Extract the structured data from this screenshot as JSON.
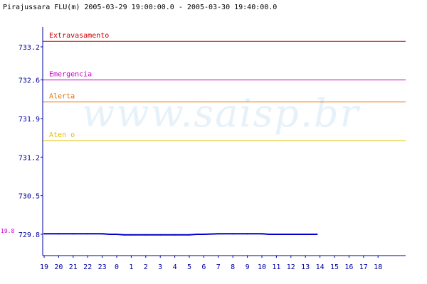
{
  "chart_data": {
    "type": "line",
    "title": "Pirajussara FLU(m) 2005-03-29 19:00:00.0 - 2005-03-30 19:40:00.0",
    "watermark": "www.saisp.br",
    "ylim": [
      729.8,
      733.5
    ],
    "y_ticks": [
      {
        "value": 733.2,
        "label": "733.2"
      },
      {
        "value": 732.6,
        "label": "732.6"
      },
      {
        "value": 731.9,
        "label": "731.9"
      },
      {
        "value": 731.2,
        "label": "731.2"
      },
      {
        "value": 730.5,
        "label": "730.5"
      },
      {
        "value": 729.8,
        "label": "729.8"
      }
    ],
    "x_ticks": [
      "19",
      "20",
      "21",
      "22",
      "23",
      "0",
      "1",
      "2",
      "3",
      "4",
      "5",
      "6",
      "7",
      "8",
      "9",
      "10",
      "11",
      "12",
      "13",
      "14",
      "15",
      "16",
      "17",
      "18"
    ],
    "thresholds": [
      {
        "name": "Extravasamento",
        "value": 733.3,
        "color": "#cc0000"
      },
      {
        "name": "Emergencia",
        "value": 732.6,
        "color": "#cc00cc"
      },
      {
        "name": "Alerta",
        "value": 732.2,
        "color": "#e07000"
      },
      {
        "name": "Aten  o",
        "value": 731.5,
        "color": "#e0c000"
      }
    ],
    "series": [
      {
        "color": "#0000cc",
        "x": [
          0,
          1,
          2,
          3,
          4,
          4.5,
          5,
          5.5,
          6,
          7,
          8,
          9,
          10,
          10.5,
          11,
          12,
          13,
          14,
          15,
          15.5,
          16,
          17,
          18,
          18.8
        ],
        "values": [
          729.81,
          729.81,
          729.81,
          729.81,
          729.81,
          729.8,
          729.8,
          729.79,
          729.79,
          729.79,
          729.79,
          729.79,
          729.79,
          729.8,
          729.8,
          729.81,
          729.81,
          729.81,
          729.81,
          729.8,
          729.8,
          729.8,
          729.8,
          729.8
        ]
      }
    ],
    "current_value": {
      "label": "19.8",
      "color": "#cc00cc"
    },
    "colors": {
      "axis": "#0000a0",
      "tick_text": "#0000a0",
      "watermark": "#e6f1f9"
    },
    "grid": false
  }
}
